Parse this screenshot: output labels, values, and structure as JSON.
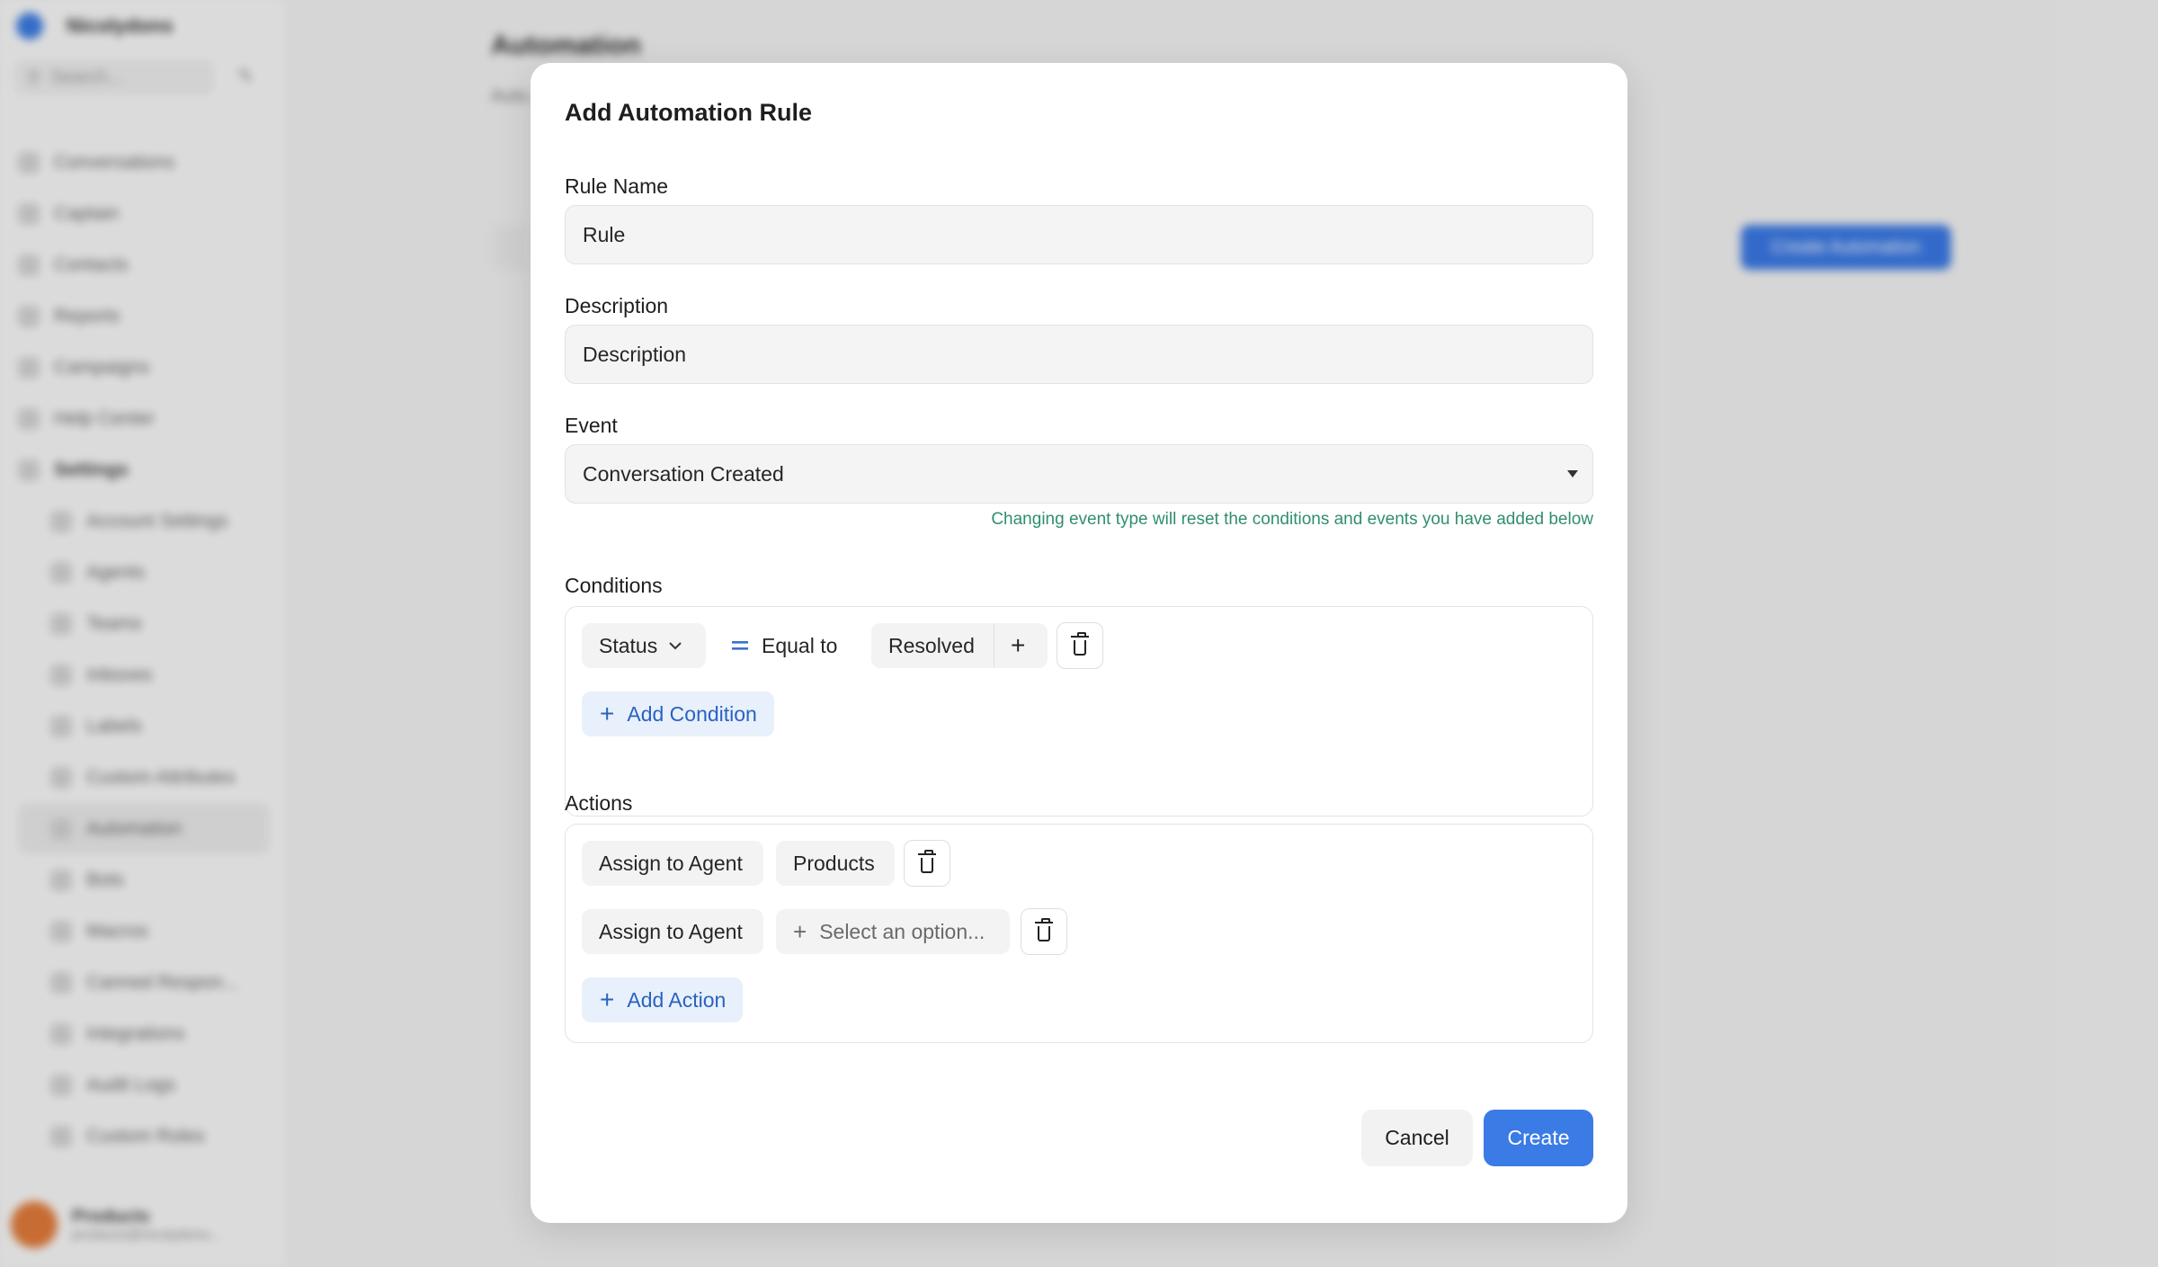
{
  "background": {
    "brand_name": "Nicolydons",
    "search_placeholder": "Search...",
    "nav_items": [
      "Conversations",
      "Captain",
      "Contacts",
      "Reports",
      "Campaigns",
      "Help Center",
      "Settings"
    ],
    "settings_items": [
      "Account Settings",
      "Agents",
      "Teams",
      "Inboxes",
      "Labels",
      "Custom Attributes",
      "Automation",
      "Bots",
      "Macros",
      "Canned Respon...",
      "Integrations",
      "Audit Logs",
      "Custom Roles"
    ],
    "user_name": "Products",
    "user_email": "products@nicolydons...",
    "page_title": "Automation",
    "page_description": "Auto...",
    "create_button": "Create Automation"
  },
  "modal": {
    "title": "Add Automation Rule",
    "rule_name": {
      "label": "Rule Name",
      "value": "Rule"
    },
    "description": {
      "label": "Description",
      "value": "Description"
    },
    "event": {
      "label": "Event",
      "value": "Conversation Created",
      "hint": "Changing event type will reset the conditions and events you have added below"
    },
    "conditions": {
      "label": "Conditions",
      "attribute": "Status",
      "operator": "Equal to",
      "value": "Resolved",
      "add_label": "Add Condition"
    },
    "actions": {
      "label": "Actions",
      "rows": [
        {
          "action": "Assign to Agent",
          "value": "Products"
        },
        {
          "action": "Assign to Agent",
          "placeholder": "Select an option..."
        }
      ],
      "add_label": "Add Action"
    },
    "cancel_label": "Cancel",
    "create_label": "Create"
  },
  "colors": {
    "primary": "#3b7be6",
    "hint": "#2f8f6b",
    "add_button_bg": "#e8f0fb",
    "add_button_text": "#2b62c0"
  }
}
